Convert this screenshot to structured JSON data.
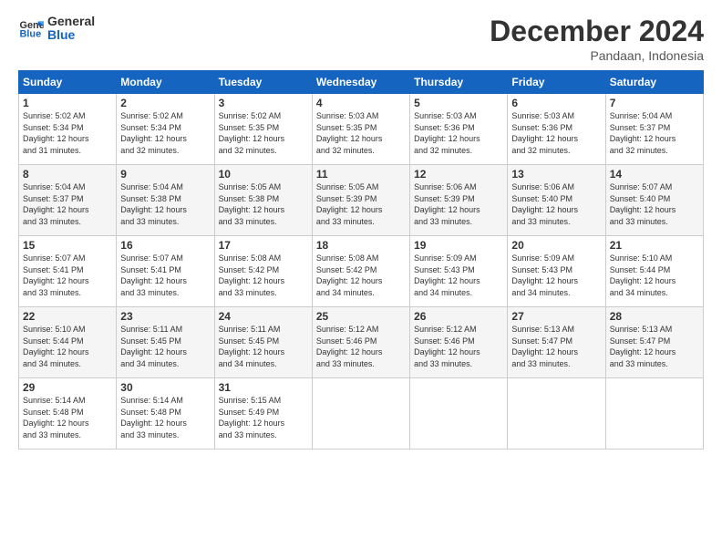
{
  "header": {
    "logo_line1": "General",
    "logo_line2": "Blue",
    "month_title": "December 2024",
    "location": "Pandaan, Indonesia"
  },
  "weekdays": [
    "Sunday",
    "Monday",
    "Tuesday",
    "Wednesday",
    "Thursday",
    "Friday",
    "Saturday"
  ],
  "weeks": [
    [
      {
        "day": "1",
        "info": "Sunrise: 5:02 AM\nSunset: 5:34 PM\nDaylight: 12 hours\nand 31 minutes."
      },
      {
        "day": "2",
        "info": "Sunrise: 5:02 AM\nSunset: 5:34 PM\nDaylight: 12 hours\nand 32 minutes."
      },
      {
        "day": "3",
        "info": "Sunrise: 5:02 AM\nSunset: 5:35 PM\nDaylight: 12 hours\nand 32 minutes."
      },
      {
        "day": "4",
        "info": "Sunrise: 5:03 AM\nSunset: 5:35 PM\nDaylight: 12 hours\nand 32 minutes."
      },
      {
        "day": "5",
        "info": "Sunrise: 5:03 AM\nSunset: 5:36 PM\nDaylight: 12 hours\nand 32 minutes."
      },
      {
        "day": "6",
        "info": "Sunrise: 5:03 AM\nSunset: 5:36 PM\nDaylight: 12 hours\nand 32 minutes."
      },
      {
        "day": "7",
        "info": "Sunrise: 5:04 AM\nSunset: 5:37 PM\nDaylight: 12 hours\nand 32 minutes."
      }
    ],
    [
      {
        "day": "8",
        "info": "Sunrise: 5:04 AM\nSunset: 5:37 PM\nDaylight: 12 hours\nand 33 minutes."
      },
      {
        "day": "9",
        "info": "Sunrise: 5:04 AM\nSunset: 5:38 PM\nDaylight: 12 hours\nand 33 minutes."
      },
      {
        "day": "10",
        "info": "Sunrise: 5:05 AM\nSunset: 5:38 PM\nDaylight: 12 hours\nand 33 minutes."
      },
      {
        "day": "11",
        "info": "Sunrise: 5:05 AM\nSunset: 5:39 PM\nDaylight: 12 hours\nand 33 minutes."
      },
      {
        "day": "12",
        "info": "Sunrise: 5:06 AM\nSunset: 5:39 PM\nDaylight: 12 hours\nand 33 minutes."
      },
      {
        "day": "13",
        "info": "Sunrise: 5:06 AM\nSunset: 5:40 PM\nDaylight: 12 hours\nand 33 minutes."
      },
      {
        "day": "14",
        "info": "Sunrise: 5:07 AM\nSunset: 5:40 PM\nDaylight: 12 hours\nand 33 minutes."
      }
    ],
    [
      {
        "day": "15",
        "info": "Sunrise: 5:07 AM\nSunset: 5:41 PM\nDaylight: 12 hours\nand 33 minutes."
      },
      {
        "day": "16",
        "info": "Sunrise: 5:07 AM\nSunset: 5:41 PM\nDaylight: 12 hours\nand 33 minutes."
      },
      {
        "day": "17",
        "info": "Sunrise: 5:08 AM\nSunset: 5:42 PM\nDaylight: 12 hours\nand 33 minutes."
      },
      {
        "day": "18",
        "info": "Sunrise: 5:08 AM\nSunset: 5:42 PM\nDaylight: 12 hours\nand 34 minutes."
      },
      {
        "day": "19",
        "info": "Sunrise: 5:09 AM\nSunset: 5:43 PM\nDaylight: 12 hours\nand 34 minutes."
      },
      {
        "day": "20",
        "info": "Sunrise: 5:09 AM\nSunset: 5:43 PM\nDaylight: 12 hours\nand 34 minutes."
      },
      {
        "day": "21",
        "info": "Sunrise: 5:10 AM\nSunset: 5:44 PM\nDaylight: 12 hours\nand 34 minutes."
      }
    ],
    [
      {
        "day": "22",
        "info": "Sunrise: 5:10 AM\nSunset: 5:44 PM\nDaylight: 12 hours\nand 34 minutes."
      },
      {
        "day": "23",
        "info": "Sunrise: 5:11 AM\nSunset: 5:45 PM\nDaylight: 12 hours\nand 34 minutes."
      },
      {
        "day": "24",
        "info": "Sunrise: 5:11 AM\nSunset: 5:45 PM\nDaylight: 12 hours\nand 34 minutes."
      },
      {
        "day": "25",
        "info": "Sunrise: 5:12 AM\nSunset: 5:46 PM\nDaylight: 12 hours\nand 33 minutes."
      },
      {
        "day": "26",
        "info": "Sunrise: 5:12 AM\nSunset: 5:46 PM\nDaylight: 12 hours\nand 33 minutes."
      },
      {
        "day": "27",
        "info": "Sunrise: 5:13 AM\nSunset: 5:47 PM\nDaylight: 12 hours\nand 33 minutes."
      },
      {
        "day": "28",
        "info": "Sunrise: 5:13 AM\nSunset: 5:47 PM\nDaylight: 12 hours\nand 33 minutes."
      }
    ],
    [
      {
        "day": "29",
        "info": "Sunrise: 5:14 AM\nSunset: 5:48 PM\nDaylight: 12 hours\nand 33 minutes."
      },
      {
        "day": "30",
        "info": "Sunrise: 5:14 AM\nSunset: 5:48 PM\nDaylight: 12 hours\nand 33 minutes."
      },
      {
        "day": "31",
        "info": "Sunrise: 5:15 AM\nSunset: 5:49 PM\nDaylight: 12 hours\nand 33 minutes."
      },
      {
        "day": "",
        "info": ""
      },
      {
        "day": "",
        "info": ""
      },
      {
        "day": "",
        "info": ""
      },
      {
        "day": "",
        "info": ""
      }
    ]
  ]
}
